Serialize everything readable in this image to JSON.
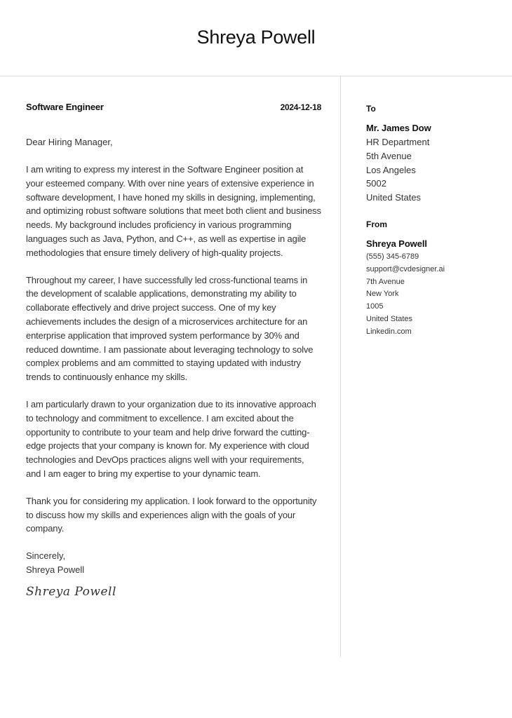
{
  "header": {
    "name": "Shreya Powell"
  },
  "letter": {
    "job_title": "Software Engineer",
    "date": "2024-12-18",
    "salutation": "Dear Hiring Manager,",
    "paragraphs": [
      "I am writing to express my interest in the Software Engineer position at your esteemed company. With over nine years of extensive experience in software development, I have honed my skills in designing, implementing, and optimizing robust software solutions that meet both client and business needs. My background includes proficiency in various programming languages such as Java, Python, and C++, as well as expertise in agile methodologies that ensure timely delivery of high-quality projects.",
      "Throughout my career, I have successfully led cross-functional teams in the development of scalable applications, demonstrating my ability to collaborate effectively and drive project success. One of my key achievements includes the design of a microservices architecture for an enterprise application that improved system performance by 30% and reduced downtime. I am passionate about leveraging technology to solve complex problems and am committed to staying updated with industry trends to continuously enhance my skills.",
      "I am particularly drawn to your organization due to its innovative approach to technology and commitment to excellence. I am excited about the opportunity to contribute to your team and help drive forward the cutting-edge projects that your company is known for. My experience with cloud technologies and DevOps practices aligns well with your requirements, and I am eager to bring my expertise to your dynamic team.",
      "Thank you for considering my application. I look forward to the opportunity to discuss how my skills and experiences align with the goals of your company."
    ],
    "closing": "Sincerely,",
    "closing_name": "Shreya Powell",
    "signature": "Shreya Powell"
  },
  "recipient": {
    "label": "To",
    "name": "Mr. James Dow",
    "lines": [
      "HR Department",
      "5th Avenue",
      "Los Angeles",
      "5002",
      "United States"
    ]
  },
  "sender": {
    "label": "From",
    "name": "Shreya Powell",
    "phone": "(555) 345-6789",
    "email": "support@cvdesigner.ai",
    "street": "7th Avenue",
    "city": "New York",
    "zip": "1005",
    "country": "United States",
    "website": "Linkedin.com"
  }
}
